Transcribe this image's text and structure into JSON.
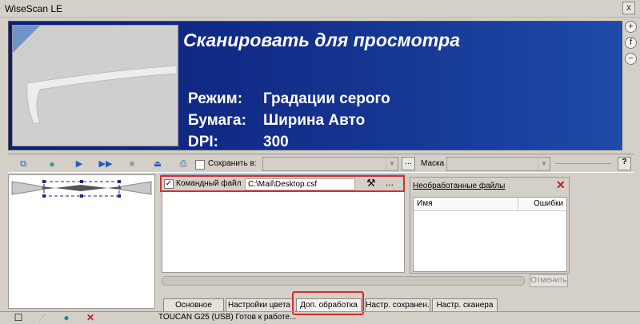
{
  "window": {
    "title": "WiseScan LE",
    "close_symbol": "x"
  },
  "banner": {
    "title": "Сканировать для просмотра",
    "rows": [
      {
        "label": "Режим:",
        "value": "Градации серого"
      },
      {
        "label": "Бумага:",
        "value": "Ширина Авто"
      },
      {
        "label": "DPI:",
        "value": "300"
      }
    ]
  },
  "side_buttons": {
    "zoom_in": "+",
    "fit": "f",
    "zoom_out": "−"
  },
  "toolbar": {
    "save_to_label": "Сохранить в:",
    "save_to_value": "",
    "mask_label": "Маска",
    "mask_value": "",
    "browse_label": "...",
    "help_label": "?"
  },
  "command_file": {
    "label": "Командный файл",
    "path": "C:\\Mail\\Desktop.csf",
    "more": "..."
  },
  "raw_files": {
    "title": "Необработанные файлы",
    "columns": [
      "Имя",
      "Ошибки"
    ]
  },
  "cancel_label": "Отменить",
  "tabs": [
    "Основное",
    "Настройки цвета",
    "Доп. обработка",
    "Настр. сохранен.",
    "Настр. сканера"
  ],
  "active_tab": "Доп. обработка",
  "status": {
    "text": "TOUCAN G25 (USB) Готов к работе..."
  },
  "colors": {
    "banner": "#0a1e78",
    "highlight": "#d03030",
    "accent_blue": "#1f5fbf"
  }
}
